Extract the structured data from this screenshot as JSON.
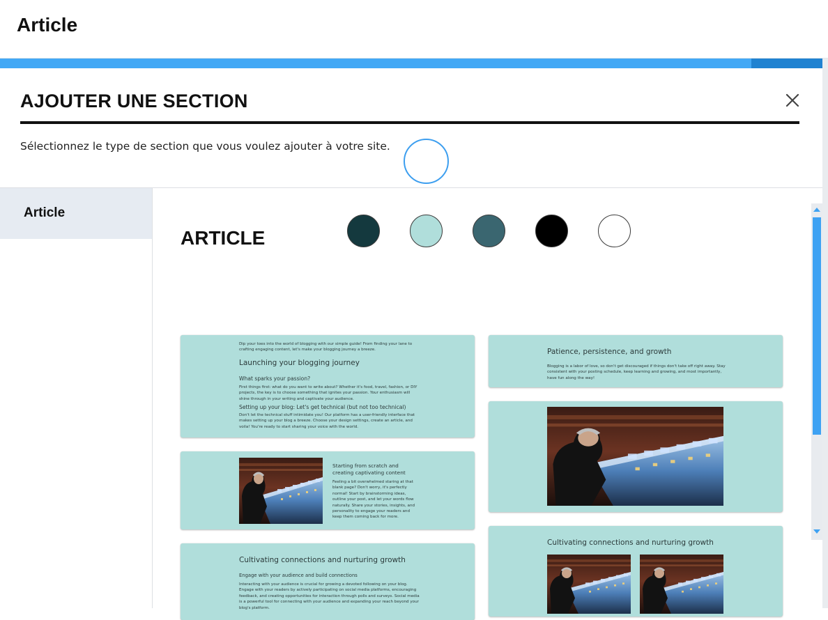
{
  "app": {
    "title": "Article"
  },
  "modal": {
    "title": "AJOUTER UNE SECTION",
    "subtitle": "Sélectionnez le type de section que vous voulez ajouter à votre site.",
    "close_icon": "close-icon"
  },
  "sidebar": {
    "items": [
      {
        "label": "Article",
        "selected": true
      }
    ]
  },
  "swatches": [
    {
      "color": "#14393e",
      "selected": false
    },
    {
      "color": "#b0dedb",
      "selected": true
    },
    {
      "color": "#3a6670",
      "selected": false
    },
    {
      "color": "#000000",
      "selected": false
    },
    {
      "color": "#ffffff",
      "selected": false
    }
  ],
  "colors": {
    "accent": "#42a8f5",
    "accent_dark": "#1f82d1",
    "card_bg": "#b0dedb"
  },
  "content": {
    "heading": "ARTICLE",
    "card1": {
      "intro": "Dip your toes into the world of blogging with our simple guide! From finding your lane to crafting engaging content, let's make your blogging journey a breeze.",
      "title": "Launching your blogging journey",
      "sub1": "What sparks your passion?",
      "p1": "First things first: what do you want to write about? Whether it's food, travel, fashion, or DIY projects, the key is to choose something that ignites your passion. Your enthusiasm will shine through in your writing and captivate your audience.",
      "sub2": "Setting up your blog: Let's get technical (but not too technical)",
      "p2": "Don't let the technical stuff intimidate you! Our platform has a user-friendly interface that makes setting up your blog a breeze. Choose your design settings, create an article, and voila! You're ready to start sharing your voice with the world."
    },
    "card2": {
      "title": "Starting from scratch and creating captivating content",
      "p": "Feeling a bit overwhelmed staring at that blank page? Don't worry, it's perfectly normal! Start by brainstorming ideas, outline your post, and let your words flow naturally. Share your stories, insights, and personality to engage your readers and keep them coming back for more."
    },
    "card3": {
      "title": "Cultivating connections and nurturing growth",
      "sub": "Engage with your audience and build connections",
      "p": "Interacting with your audience is crucial for growing a devoted following on your blog. Engage with your readers by actively participating on social media platforms, encouraging feedback, and creating opportunities for interaction through polls and surveys. Social media is a powerful tool for connecting with your audience and expanding your reach beyond your blog's platform."
    },
    "card4": {
      "title": "Patience, persistence, and growth",
      "p": "Blogging is a labor of love, so don't get discouraged if things don't take off right away. Stay consistent with your posting schedule, keep learning and growing, and most importantly, have fun along the way!"
    },
    "card6": {
      "title": "Cultivating connections and nurturing growth"
    }
  }
}
